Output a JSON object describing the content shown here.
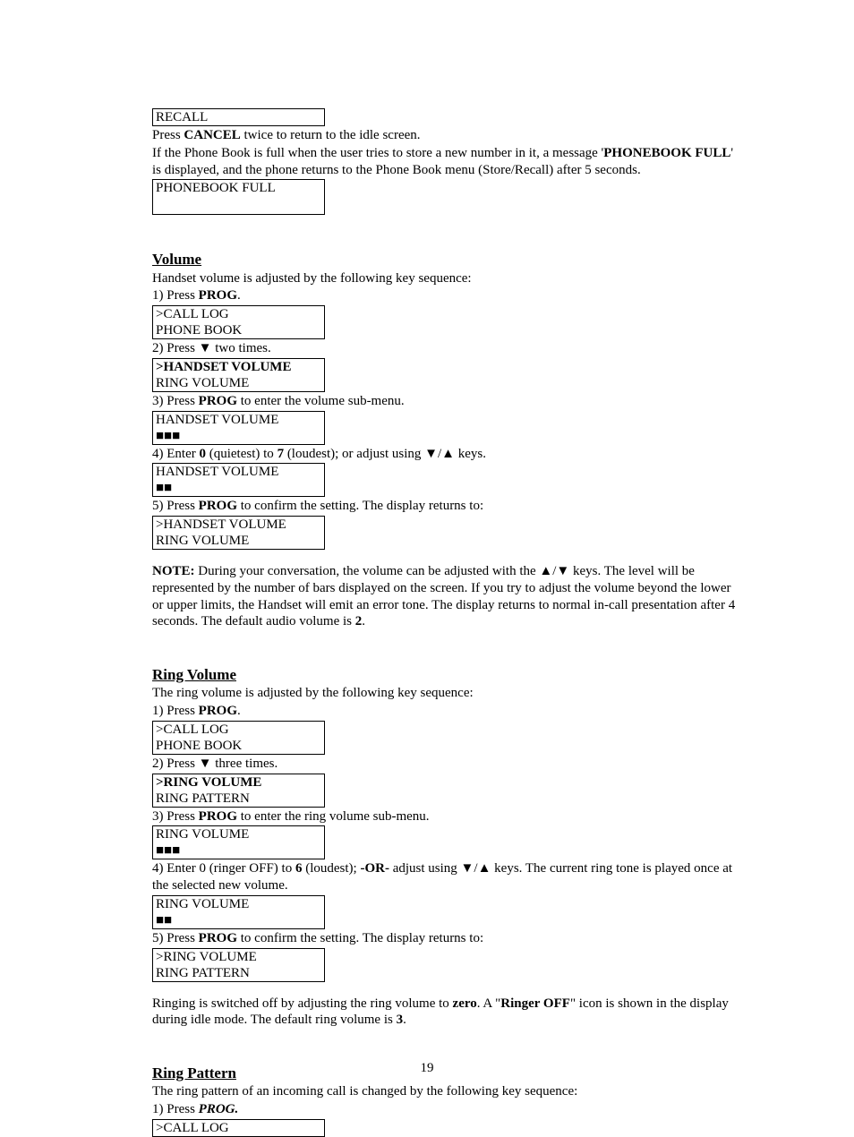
{
  "top": {
    "lcd1": " RECALL",
    "p1a": "Press ",
    "p1b": "CANCEL",
    "p1c": " twice to return to the idle screen.",
    "p2a": "If the Phone Book is full when the user tries to store a new number in it, a message '",
    "p2b": "PHONEBOOK FULL",
    "p2c": "' is displayed, and the phone returns to the Phone Book menu (Store/Recall) after 5 seconds.",
    "lcd2": "PHONEBOOK FULL"
  },
  "volume": {
    "title": "Volume",
    "intro": "Handset volume is adjusted by the following key sequence:",
    "s1a": "1) Press ",
    "s1b": "PROG",
    "s1c": ".",
    "lcd1a": ">CALL LOG",
    "lcd1b": " PHONE BOOK",
    "s2": "2) Press ▼ two times.",
    "lcd2a": ">HANDSET VOLUME",
    "lcd2b": " RING VOLUME",
    "s3a": "3) Press ",
    "s3b": "PROG",
    "s3c": " to enter the volume sub-menu.",
    "lcd3a": "HANDSET VOLUME",
    "lcd3b": "■■■",
    "s4a": "4) Enter ",
    "s4b": "0",
    "s4c": " (quietest) to ",
    "s4d": "7",
    "s4e": " (loudest); or adjust using ▼/▲ keys.",
    "lcd4a": "HANDSET VOLUME",
    "lcd4b": "■■",
    "s5a": "5) Press ",
    "s5b": "PROG",
    "s5c": " to confirm the setting.  The display returns to:",
    "lcd5a": ">HANDSET VOLUME",
    "lcd5b": " RING VOLUME",
    "note_a": "NOTE:",
    "note_b": " During your conversation, the volume can be adjusted with the ▲/▼ keys. The level will be represented by the number of bars displayed on the screen. If you try to adjust the volume beyond the lower or upper limits, the Handset will emit an error tone. The display returns to normal in-call presentation after 4 seconds.  The default audio volume is ",
    "note_c": "2",
    "note_d": "."
  },
  "ring": {
    "title": "Ring Volume",
    "intro": "The ring volume is adjusted by the following key sequence:",
    "s1a": "1) Press ",
    "s1b": "PROG",
    "s1c": ".",
    "lcd1a": ">CALL LOG",
    "lcd1b": " PHONE BOOK",
    "s2": "2) Press ▼ three times.",
    "lcd2a": ">RING VOLUME",
    "lcd2b": " RING PATTERN",
    "s3a": "3) Press ",
    "s3b": "PROG",
    "s3c": " to enter the ring volume sub-menu.",
    "lcd3a": "RING VOLUME",
    "lcd3b": "■■■",
    "s4a": "4) Enter 0 (ringer OFF) to ",
    "s4b": "6",
    "s4c": " (loudest);  ",
    "s4d": "-OR-",
    "s4e": "  adjust using ▼/▲ keys. The current ring tone is played once at the selected new volume.",
    "lcd4a": "RING VOLUME",
    "lcd4b": "■■",
    "s5a": "5) Press ",
    "s5b": "PROG",
    "s5c": " to confirm the setting.  The display returns to:",
    "lcd5a": ">RING VOLUME",
    "lcd5b": " RING PATTERN",
    "foot_a": "Ringing is switched off by adjusting the ring volume to ",
    "foot_b": "zero",
    "foot_c": ". A \"",
    "foot_d": "Ringer OFF",
    "foot_e": "\" icon is shown in the display during idle mode.  The default ring volume is ",
    "foot_f": "3",
    "foot_g": "."
  },
  "pattern": {
    "title": "Ring Pattern",
    "intro": "The ring pattern of an incoming call is changed by the following key sequence:",
    "s1a": "1) Press ",
    "s1b": "PROG.",
    "lcd1a": ">CALL LOG"
  },
  "pagenum": "19"
}
